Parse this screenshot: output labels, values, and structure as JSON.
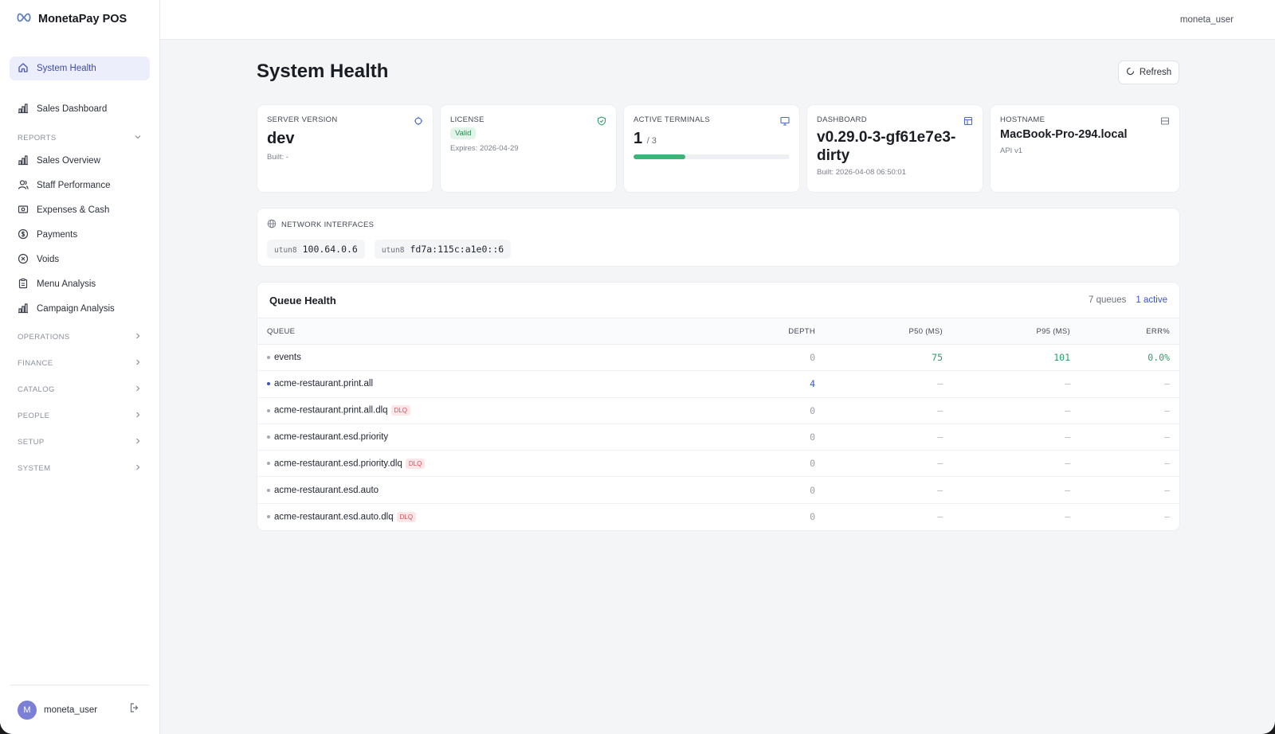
{
  "brand": {
    "name": "MonetaPay POS"
  },
  "topbar": {
    "user": "moneta_user"
  },
  "sidebar": {
    "active_item": "System Health",
    "top_items": [
      {
        "label": "System Health",
        "icon": "home-icon"
      },
      {
        "label": "Sales Dashboard",
        "icon": "bar-chart-icon"
      }
    ],
    "reports": {
      "label": "REPORTS",
      "expanded": true,
      "items": [
        {
          "label": "Sales Overview",
          "icon": "bar-chart-icon"
        },
        {
          "label": "Staff Performance",
          "icon": "users-icon"
        },
        {
          "label": "Expenses & Cash",
          "icon": "cash-icon"
        },
        {
          "label": "Payments",
          "icon": "dollar-circle-icon"
        },
        {
          "label": "Voids",
          "icon": "x-circle-icon"
        },
        {
          "label": "Menu Analysis",
          "icon": "clipboard-icon"
        },
        {
          "label": "Campaign Analysis",
          "icon": "bar-chart-icon"
        }
      ]
    },
    "sections": [
      {
        "label": "OPERATIONS"
      },
      {
        "label": "FINANCE"
      },
      {
        "label": "CATALOG"
      },
      {
        "label": "PEOPLE"
      },
      {
        "label": "SETUP"
      },
      {
        "label": "SYSTEM"
      }
    ],
    "footer": {
      "avatar_initial": "M",
      "user": "moneta_user"
    }
  },
  "page": {
    "title": "System Health",
    "refresh_label": "Refresh"
  },
  "cards": {
    "server_version": {
      "label": "SERVER VERSION",
      "value": "dev",
      "sub": "Built: -"
    },
    "license": {
      "label": "LICENSE",
      "status": "Valid",
      "sub": "Expires: 2026-04-29"
    },
    "active_terminals": {
      "label": "ACTIVE TERMINALS",
      "value": "1",
      "total": "/ 3",
      "progress": 0.33
    },
    "dashboard": {
      "label": "DASHBOARD",
      "value": "v0.29.0-3-gf61e7e3-dirty",
      "value_line1": "v0.29.0-3-gf61e7e3-",
      "value_line2": "dirty",
      "sub": "Built: 2026-04-08 06:50:01"
    },
    "hostname": {
      "label": "HOSTNAME",
      "value": "MacBook-Pro-294.local",
      "sub": "API v1"
    }
  },
  "network": {
    "label": "NETWORK INTERFACES",
    "interfaces": [
      {
        "name": "utun8",
        "address": "100.64.0.6"
      },
      {
        "name": "utun8",
        "address": "fd7a:115c:a1e0::6"
      }
    ]
  },
  "queue_health": {
    "title": "Queue Health",
    "count_label": "7 queues",
    "active_label": "1 active",
    "columns": [
      "QUEUE",
      "DEPTH",
      "P50 (MS)",
      "P95 (MS)",
      "ERR%"
    ],
    "rows": [
      {
        "name": "events",
        "dlq": false,
        "active": false,
        "depth": "0",
        "p50": "75",
        "p95": "101",
        "err": "0.0%"
      },
      {
        "name": "acme-restaurant.print.all",
        "dlq": false,
        "active": true,
        "depth": "4",
        "p50": "—",
        "p95": "—",
        "err": "—"
      },
      {
        "name": "acme-restaurant.print.all.dlq",
        "dlq": true,
        "active": false,
        "depth": "0",
        "p50": "—",
        "p95": "—",
        "err": "—"
      },
      {
        "name": "acme-restaurant.esd.priority",
        "dlq": false,
        "active": false,
        "depth": "0",
        "p50": "—",
        "p95": "—",
        "err": "—"
      },
      {
        "name": "acme-restaurant.esd.priority.dlq",
        "dlq": true,
        "active": false,
        "depth": "0",
        "p50": "—",
        "p95": "—",
        "err": "—"
      },
      {
        "name": "acme-restaurant.esd.auto",
        "dlq": false,
        "active": false,
        "depth": "0",
        "p50": "—",
        "p95": "—",
        "err": "—"
      },
      {
        "name": "acme-restaurant.esd.auto.dlq",
        "dlq": true,
        "active": false,
        "depth": "0",
        "p50": "—",
        "p95": "—",
        "err": "—"
      }
    ],
    "dlq_badge": "DLQ"
  },
  "colors": {
    "accent": "#3a55c4",
    "success": "#3bb47a",
    "danger": "#d2505a",
    "active_nav_bg": "#eceefb"
  }
}
